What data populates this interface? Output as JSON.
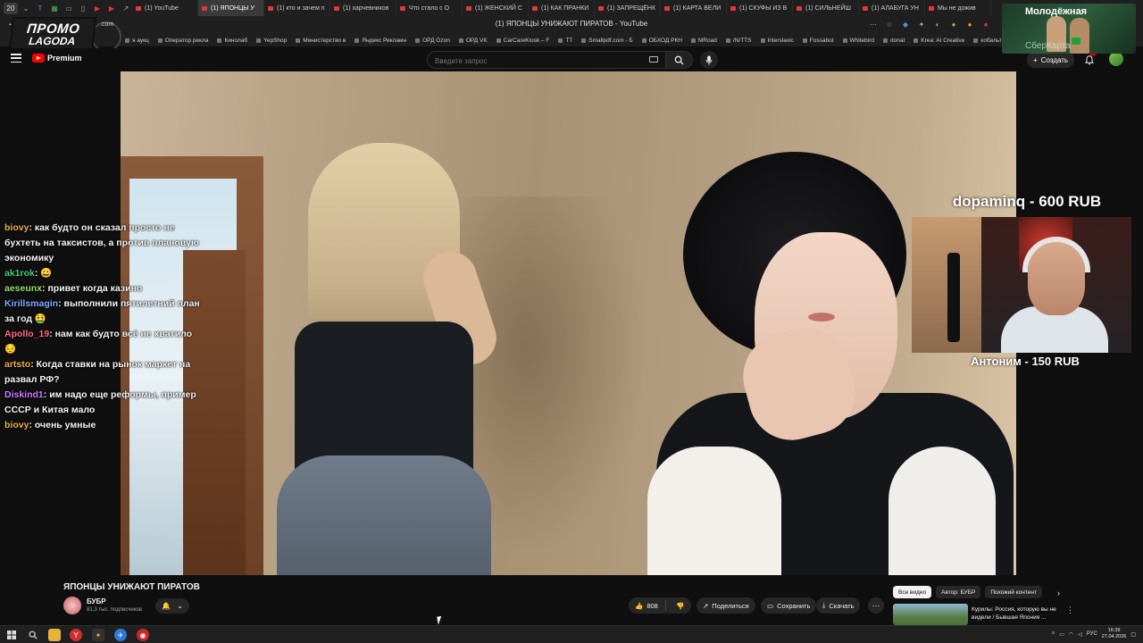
{
  "browser": {
    "tab_count": "20",
    "tabs": [
      {
        "label": "(1) YouTube",
        "active": false
      },
      {
        "label": "(1) ЯПОНЦЫ У",
        "active": true
      },
      {
        "label": "(1) кто и зачем п",
        "active": false
      },
      {
        "label": "(1) харчевников",
        "active": false
      },
      {
        "label": "Что стало с О",
        "active": false
      },
      {
        "label": "(1) ЖЕНСКИЙ С",
        "active": false
      },
      {
        "label": "(1) КАК ПРАНКИ",
        "active": false
      },
      {
        "label": "(1) ЗАПРЕЩЁНК",
        "active": false
      },
      {
        "label": "(1) КАРТА ВЕЛИ",
        "active": false
      },
      {
        "label": "(1) СКУФЫ ИЗ В",
        "active": false
      },
      {
        "label": "(1) СИЛЬНЕЙШ",
        "active": false
      },
      {
        "label": "(1) АЛАБУГА УН",
        "active": false
      },
      {
        "label": "Мы не дожив",
        "active": false
      }
    ],
    "page_title": "(1) ЯПОНЦЫ УНИЖАЮТ ПИРАТОВ - YouTube",
    "bookmarks": [
      "я аукц",
      "Оператор рекла",
      "Кинолаб",
      "YepShop",
      "Министерство в",
      "Яндекс Рекламн",
      "ОРД Ozon",
      "ОРД VK",
      "CarCareKiosk – F",
      "TT",
      "Smallpdf.com - Б",
      "ОБХОД РКН",
      "MRoad",
      "/N/TTS",
      "Interslavic",
      "Fossabot",
      "Whitebird",
      "donat",
      "Krea: AI Creative",
      "кобальт"
    ]
  },
  "promo": {
    "line1": "ПРОМО",
    "line2": "LAGODA",
    "domain": ".com"
  },
  "sponsor": {
    "title": "Молодёжная",
    "subtitle": "СберКарта"
  },
  "youtube": {
    "logo_text": "Premium",
    "search_placeholder": "Введите запрос",
    "create_label": "Создать",
    "bell_badge": "9+"
  },
  "chat": [
    {
      "nick": "biovy",
      "color": "#e8b04a",
      "text": "как будто он сказал просто не бухтеть на таксистов, а против плановую экономику"
    },
    {
      "nick": "ak1rok",
      "color": "#3fd17b",
      "text": "😀"
    },
    {
      "nick": "aeseunx",
      "color": "#8fe06b",
      "text": "привет когда казино"
    },
    {
      "nick": "Kirillsmagin",
      "color": "#7fa8ff",
      "text": "выполнили пятилетний план за год 🤮"
    },
    {
      "nick": "Apollo_19",
      "color": "#ff6a8a",
      "text": "нам как будто всё не хватило 😔"
    },
    {
      "nick": "artsto",
      "color": "#f0a94a",
      "text": "Когда ставки на рынок маркет на развал РФ?"
    },
    {
      "nick": "Diskind1",
      "color": "#c77dff",
      "text": "им надо еще реформы, пример СССР и Китая мало"
    },
    {
      "nick": "biovy",
      "color": "#e8b04a",
      "text": "очень умные"
    }
  ],
  "donations": {
    "top": "dopaminq - 600 RUB",
    "bottom": "Антоним - 150 RUB"
  },
  "video": {
    "title": "ЯПОНЦЫ УНИЖАЮТ ПИРАТОВ",
    "channel": "БУБР",
    "subscribers": "81,3 тыс. подписчиков",
    "likes": "808",
    "share_label": "Поделиться",
    "save_label": "Сохранить",
    "download_label": "Скачать",
    "more_label": "⋯"
  },
  "related": {
    "chips": [
      "Все видео",
      "Автор: БУБР",
      "Похожий контент"
    ],
    "first_title": "Курилы: Россия, которую вы не видели / Бывшая Япония ..."
  },
  "taskbar": {
    "lang": "РУС",
    "time": "16:39",
    "date": "27.04.2026"
  }
}
